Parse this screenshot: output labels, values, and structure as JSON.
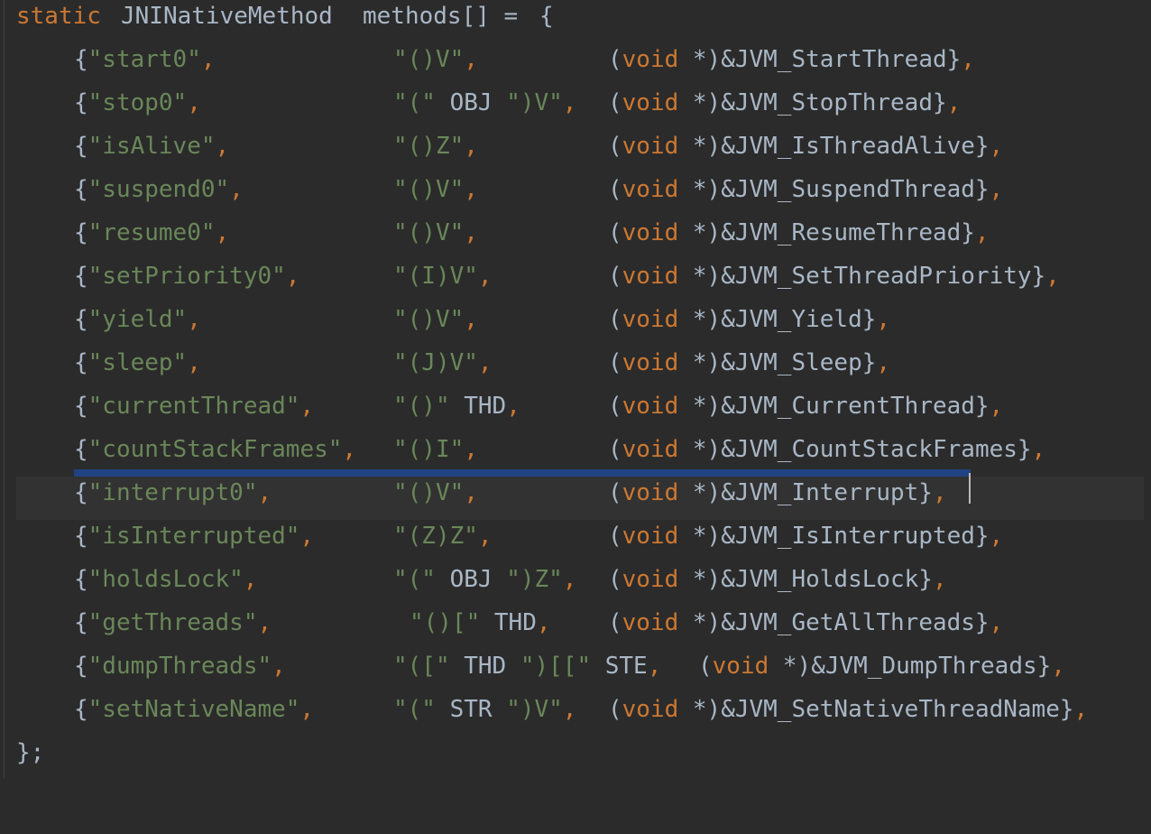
{
  "editor": {
    "header": {
      "kw_static": "static",
      "type": "JNINativeMethod",
      "name": "methods[] =",
      "open": "{"
    },
    "rows": [
      {
        "name": "\"start0\"",
        "sig": "\"()V\"",
        "fn": "&JVM_StartThread"
      },
      {
        "name": "\"stop0\"",
        "sig_parts": [
          "\"(\"",
          " OBJ ",
          "\")V\""
        ],
        "fn": "&JVM_StopThread"
      },
      {
        "name": "\"isAlive\"",
        "sig": "\"()Z\"",
        "fn": "&JVM_IsThreadAlive"
      },
      {
        "name": "\"suspend0\"",
        "sig": "\"()V\"",
        "fn": "&JVM_SuspendThread"
      },
      {
        "name": "\"resume0\"",
        "sig": "\"()V\"",
        "fn": "&JVM_ResumeThread"
      },
      {
        "name": "\"setPriority0\"",
        "sig": "\"(I)V\"",
        "fn": "&JVM_SetThreadPriority"
      },
      {
        "name": "\"yield\"",
        "sig": "\"()V\"",
        "fn": "&JVM_Yield"
      },
      {
        "name": "\"sleep\"",
        "sig": "\"(J)V\"",
        "fn": "&JVM_Sleep"
      },
      {
        "name": "\"currentThread\"",
        "sig_parts": [
          "\"()\"",
          " THD"
        ],
        "fn": "&JVM_CurrentThread"
      },
      {
        "name": "\"countStackFrames\"",
        "sig": "\"()I\"",
        "fn": "&JVM_CountStackFrames"
      },
      {
        "name": "\"interrupt0\"",
        "sig": "\"()V\"",
        "fn": "&JVM_Interrupt"
      },
      {
        "name": "\"isInterrupted\"",
        "sig": "\"(Z)Z\"",
        "fn": "&JVM_IsInterrupted"
      },
      {
        "name": "\"holdsLock\"",
        "sig_parts": [
          "\"(\"",
          " OBJ ",
          "\")Z\""
        ],
        "fn": "&JVM_HoldsLock"
      },
      {
        "name": "\"getThreads\"",
        "sig_parts": [
          "\"()[\"",
          " THD"
        ],
        "fn": "&JVM_GetAllThreads"
      },
      {
        "name": "\"dumpThreads\"",
        "sig_parts": [
          "\"([\"",
          " THD ",
          "\")[[\"",
          " STE"
        ],
        "fn": "&JVM_DumpThreads"
      },
      {
        "name": "\"setNativeName\"",
        "sig_parts": [
          "\"(\"",
          " STR ",
          "\")V\""
        ],
        "fn": "&JVM_SetNativeThreadName"
      }
    ],
    "cast_kw": "void",
    "cast_rest": " *)",
    "close": "};"
  }
}
